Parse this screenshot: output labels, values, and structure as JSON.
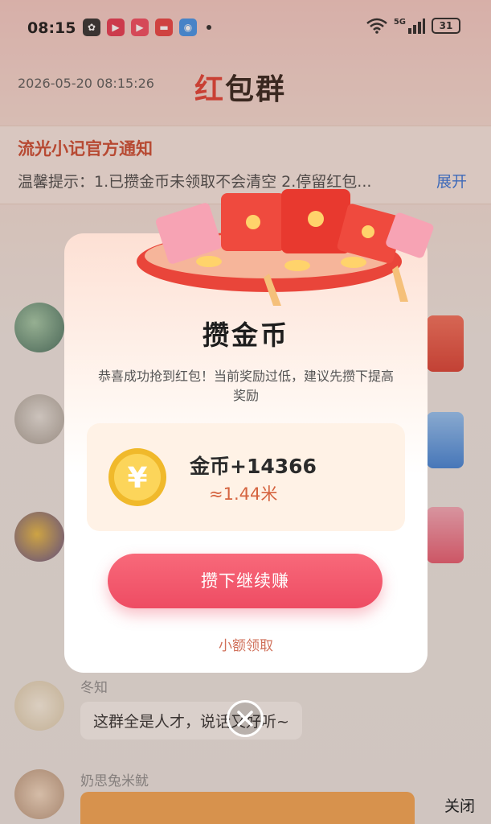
{
  "status_bar": {
    "time": "08:15",
    "network": "5G",
    "battery": "31"
  },
  "header": {
    "datetime": "2026-05-20 08:15:26",
    "title_red": "红",
    "title_rest": "包群"
  },
  "notice": {
    "title": "流光小记官方通知",
    "text": "温馨提示：1.已攒金币未领取不会清空 2.停留红包...",
    "expand": "展开"
  },
  "chat": [
    {
      "name": "冬知",
      "message": "这群全是人才，说话又好听~"
    },
    {
      "name": "奶思兔米鱿",
      "message": ""
    }
  ],
  "close_label": "关闭",
  "modal": {
    "title": "攒金币",
    "description": "恭喜成功抢到红包！当前奖励过低，建议先攒下提高奖励",
    "coins_label": "金币+14366",
    "approx_label": "≈1.44米",
    "primary_button": "攒下继续赚",
    "secondary_link": "小额领取"
  },
  "colors": {
    "accent": "#ee4c63",
    "link": "#2f6fd6",
    "notice_title": "#c9442a"
  },
  "icons": {
    "coin": "yuan-coin-icon",
    "close": "close-circle-icon"
  }
}
